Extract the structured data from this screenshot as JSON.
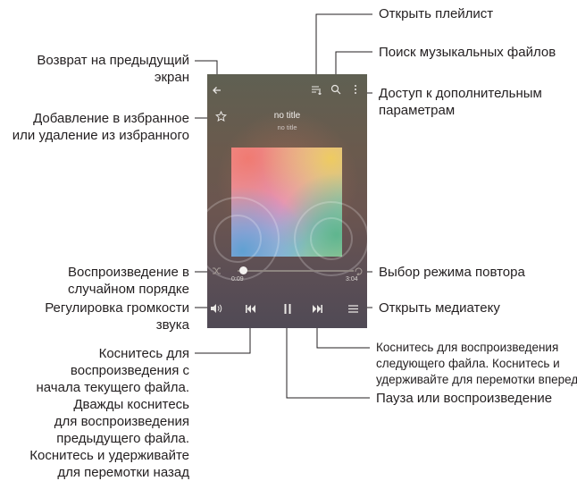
{
  "player": {
    "song_title": "no title",
    "song_artist": "no title",
    "time_elapsed": "0:09",
    "time_total": "3:04",
    "progress": 0.05
  },
  "icons": {
    "back": "arrow-left-icon",
    "playlist": "playlist-icon",
    "search": "search-icon",
    "more": "more-vertical-icon",
    "favorite": "star-outline-icon",
    "shuffle": "shuffle-icon",
    "repeat": "repeat-icon",
    "volume": "volume-icon",
    "previous": "skip-previous-icon",
    "pause": "pause-icon",
    "next": "skip-next-icon",
    "library": "library-menu-icon"
  },
  "callouts": {
    "back": [
      "Возврат на предыдущий",
      "экран"
    ],
    "favorite": [
      "Добавление в избранное",
      "или удаление из избранного"
    ],
    "shuffle": [
      "Воспроизведение в",
      "случайном порядке"
    ],
    "volume": [
      "Регулировка громкости",
      "звука"
    ],
    "previous": [
      "Коснитесь для",
      "воспроизведения с",
      "начала текущего файла.",
      "Дважды коснитесь",
      "для воспроизведения",
      "предыдущего файла.",
      "Коснитесь и удерживайте",
      "для перемотки назад"
    ],
    "playlist": [
      "Открыть плейлист"
    ],
    "search": [
      "Поиск музыкальных файлов"
    ],
    "more": [
      "Доступ к дополнительным",
      "параметрам"
    ],
    "repeat": [
      "Выбор режима повтора"
    ],
    "library": [
      "Открыть медиатеку"
    ],
    "next": [
      "Коснитесь для воспроизведения",
      "следующего файла. Коснитесь и",
      "удерживайте для перемотки вперед"
    ],
    "pause": [
      "Пауза или воспроизведение"
    ]
  }
}
